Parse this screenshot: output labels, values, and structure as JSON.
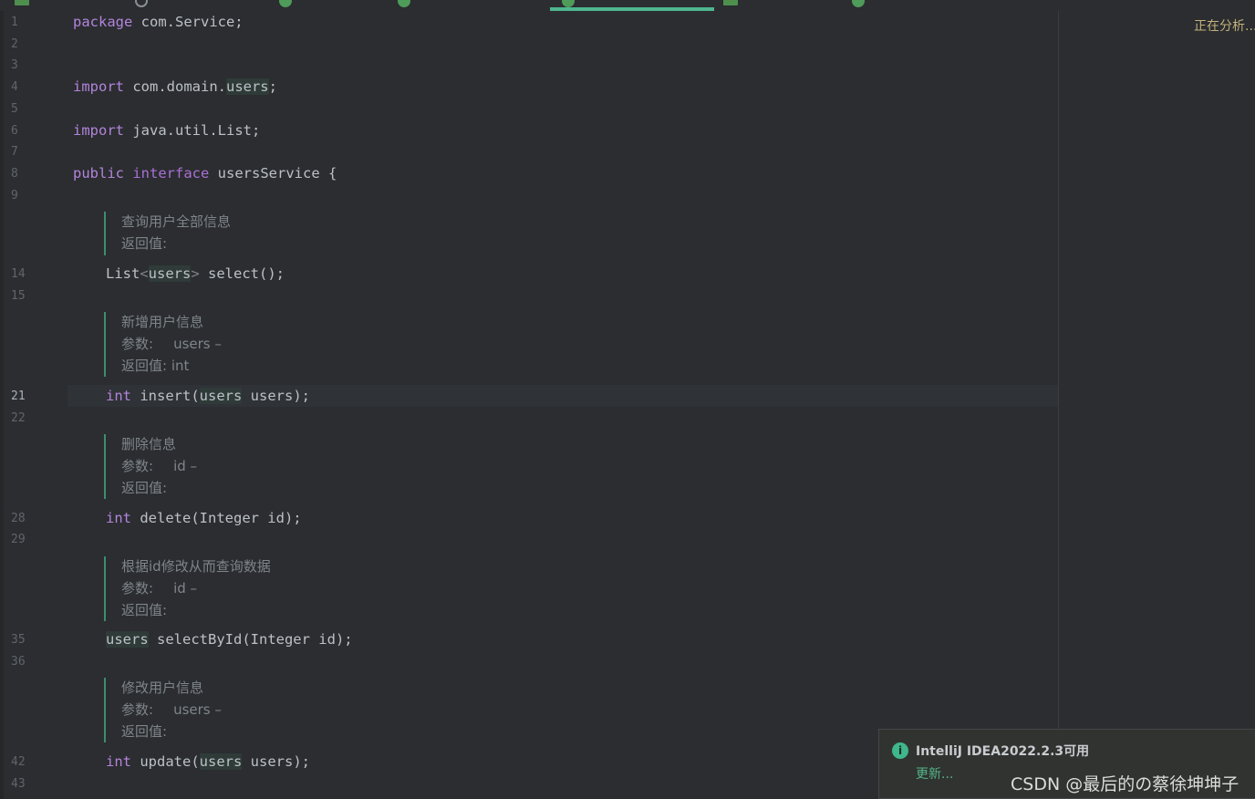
{
  "status": {
    "analyzing": "正在分析..."
  },
  "gutter": {
    "lines": [
      "1",
      "2",
      "3",
      "4",
      "5",
      "6",
      "7",
      "8",
      "9",
      "14",
      "15",
      "21",
      "22",
      "28",
      "29",
      "35",
      "36",
      "42",
      "43"
    ],
    "current": "21"
  },
  "code": {
    "l1": {
      "kw": "package",
      "rest": " com.Service;"
    },
    "l4": {
      "kw": "import",
      "pre": " com.domain.",
      "hl": "users",
      "post": ";"
    },
    "l6": {
      "kw": "import",
      "rest": " java.util.List;"
    },
    "l8": {
      "kw1": "public",
      "kw2": "interface",
      "rest": " usersService {"
    },
    "l14": {
      "a": "List",
      "lt": "<",
      "hl": "users",
      "gt": ">",
      "b": " select();"
    },
    "l21": {
      "kw": "int",
      "a": " insert(",
      "hl": "users",
      "b": " users);"
    },
    "l28": {
      "kw": "int",
      "a": " delete(Integer id);"
    },
    "l35": {
      "hl": "users",
      "a": " selectById(Integer id);"
    },
    "l42": {
      "kw": "int",
      "a": " update(",
      "hl": "users",
      "b": " users);"
    }
  },
  "docs": {
    "select": {
      "desc": "查询用户全部信息",
      "return": "返回值:"
    },
    "insert": {
      "desc": "新增用户信息",
      "param_label": "参数:",
      "param": "users –",
      "return": "返回值: int"
    },
    "delete": {
      "desc": "删除信息",
      "param_label": "参数:",
      "param": "id –",
      "return": "返回值:"
    },
    "selectById": {
      "desc": "根据id修改从而查询数据",
      "param_label": "参数:",
      "param": "id –",
      "return": "返回值:"
    },
    "update": {
      "desc": "修改用户信息",
      "param_label": "参数:",
      "param": "users –",
      "return": "返回值:"
    }
  },
  "notification": {
    "icon": "info-icon",
    "title": "IntelliJ IDEA2022.2.3可用",
    "action": "更新..."
  },
  "watermark": "CSDN @最后的の蔡徐坤坤子",
  "colors": {
    "keyword": "#b384dc",
    "accent": "#4fb58f",
    "background": "#2b2d30"
  }
}
